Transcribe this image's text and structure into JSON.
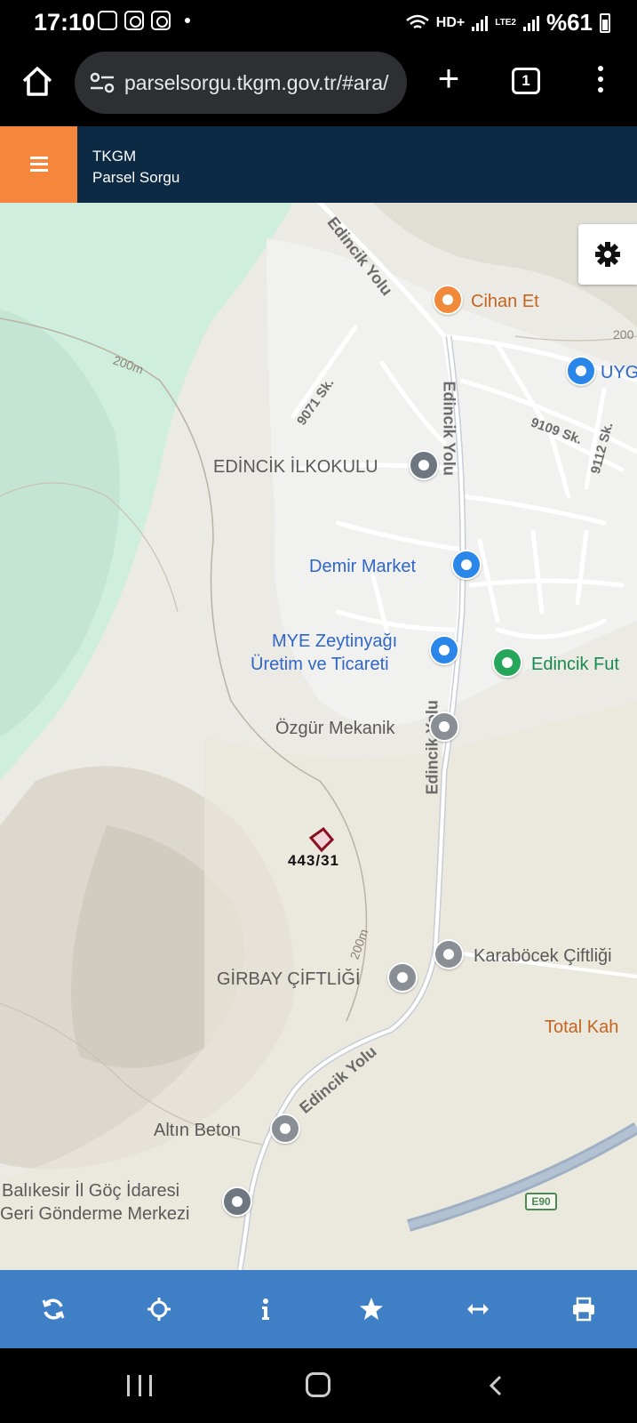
{
  "status_bar": {
    "time": "17:10",
    "network": "HD+",
    "lte": "LTE2",
    "battery": "%61"
  },
  "browser": {
    "url": "parselsorgu.tkgm.gov.tr/#ara/",
    "tab_count": "1"
  },
  "app_header": {
    "line1": "TKGM",
    "line2": "Parsel Sorgu"
  },
  "map": {
    "parcel_label": "443/31",
    "highway_badge": "E90",
    "places": {
      "cihan_et": "Cihan Et",
      "uyg": "UYG",
      "edincik_ilkokulu": "EDİNCİK İLKOKULU",
      "demir_market": "Demir Market",
      "mye_line1": "MYE Zeytinyağı",
      "mye_line2": "Üretim ve Ticareti",
      "edincik_fut": "Edincik Fut",
      "ozgur_mekanik": "Özgür Mekanik",
      "karabocek": "Karaböcek Çiftliği",
      "girbay": "GİRBAY ÇİFTLİĞİ",
      "total_kah": "Total Kah",
      "altin_beton": "Altın Beton",
      "balikesir_line1": "Balıkesir İl Göç İdaresi",
      "balikesir_line2": "Geri Gönderme Merkezi"
    },
    "streets": {
      "edincik_yolu_top": "Edincik Yolu",
      "edincik_yolu_mid": "Edincik Yolu",
      "edincik_yolu_lower": "Edincik Yolu",
      "edincik_yolu_bottom": "Edincik Yolu",
      "sk_9071": "9071 Sk.",
      "sk_9109": "9109 Sk.",
      "sk_9112": "9112 Sk.",
      "contour_200_a": "200m",
      "contour_200_b": "200m",
      "contour_200_c": "200"
    }
  },
  "toolbar_icons": [
    "refresh-icon",
    "locate-icon",
    "info-icon",
    "star-icon",
    "measure-icon",
    "print-icon"
  ],
  "colors": {
    "header": "#0c2a43",
    "menu_orange": "#f6863b",
    "toolbar_blue": "#3f7fc6"
  }
}
